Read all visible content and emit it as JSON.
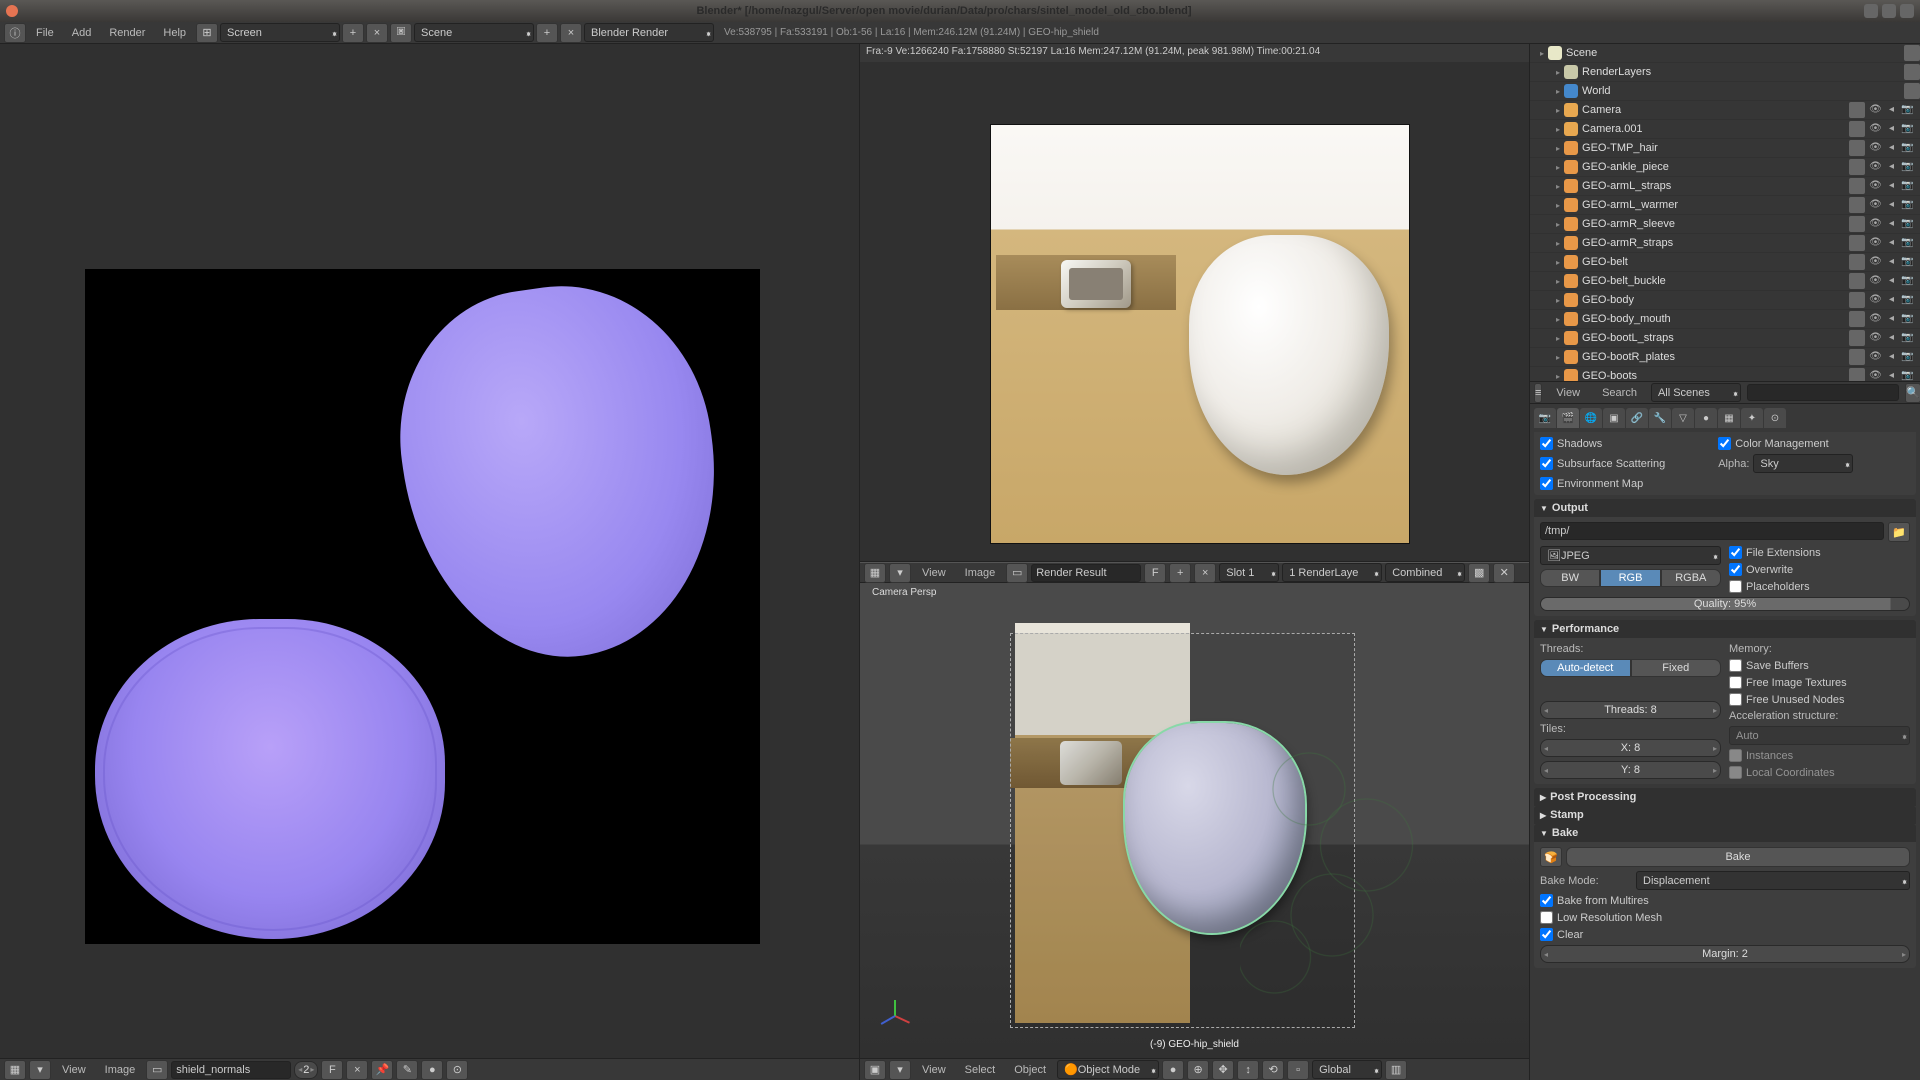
{
  "titlebar": {
    "title": "Blender* [/home/nazgul/Server/open movie/durian/Data/pro/chars/sintel_model_old_cbo.blend]"
  },
  "topmenu": {
    "file": "File",
    "add": "Add",
    "render": "Render",
    "help": "Help",
    "screen": "Screen",
    "scene": "Scene",
    "engine": "Blender Render",
    "stats": "Ve:538795 | Fa:533191 | Ob:1-56 | La:16 | Mem:246.12M (91.24M) | GEO-hip_shield"
  },
  "uvEditor": {
    "footerView": "View",
    "footerImage": "Image",
    "imageName": "shield_normals",
    "users": "2"
  },
  "renderResult": {
    "info": "Fra:-9  Ve:1266240 Fa:1758880 St:52197 La:16 Mem:247.12M (91.24M, peak 981.98M) Time:00:21.04",
    "headerView": "View",
    "headerImage": "Image",
    "headerResult": "Render Result",
    "slot": "Slot 1",
    "layer": "1 RenderLaye",
    "pass": "Combined"
  },
  "viewport3d": {
    "persp": "Camera Persp",
    "selection": "(-9) GEO-hip_shield",
    "footerView": "View",
    "footerSelect": "Select",
    "footerObject": "Object",
    "mode": "Object Mode",
    "orientation": "Global"
  },
  "outliner": {
    "view": "View",
    "search": "Search",
    "filter": "All Scenes",
    "items": [
      {
        "name": "Scene",
        "icon": "oic-scene",
        "indent": 0,
        "tog": false
      },
      {
        "name": "RenderLayers",
        "icon": "oic-render",
        "indent": 1,
        "tog": false
      },
      {
        "name": "World",
        "icon": "oic-world",
        "indent": 1,
        "tog": false
      },
      {
        "name": "Camera",
        "icon": "oic-cam",
        "indent": 1,
        "tog": true
      },
      {
        "name": "Camera.001",
        "icon": "oic-cam",
        "indent": 1,
        "tog": true
      },
      {
        "name": "GEO-TMP_hair",
        "icon": "oic-mesh",
        "indent": 1,
        "tog": true
      },
      {
        "name": "GEO-ankle_piece",
        "icon": "oic-mesh",
        "indent": 1,
        "tog": true
      },
      {
        "name": "GEO-armL_straps",
        "icon": "oic-mesh",
        "indent": 1,
        "tog": true
      },
      {
        "name": "GEO-armL_warmer",
        "icon": "oic-mesh",
        "indent": 1,
        "tog": true
      },
      {
        "name": "GEO-armR_sleeve",
        "icon": "oic-mesh",
        "indent": 1,
        "tog": true
      },
      {
        "name": "GEO-armR_straps",
        "icon": "oic-mesh",
        "indent": 1,
        "tog": true
      },
      {
        "name": "GEO-belt",
        "icon": "oic-mesh",
        "indent": 1,
        "tog": true
      },
      {
        "name": "GEO-belt_buckle",
        "icon": "oic-mesh",
        "indent": 1,
        "tog": true
      },
      {
        "name": "GEO-body",
        "icon": "oic-mesh",
        "indent": 1,
        "tog": true
      },
      {
        "name": "GEO-body_mouth",
        "icon": "oic-mesh",
        "indent": 1,
        "tog": true
      },
      {
        "name": "GEO-bootL_straps",
        "icon": "oic-mesh",
        "indent": 1,
        "tog": true
      },
      {
        "name": "GEO-bootR_plates",
        "icon": "oic-mesh",
        "indent": 1,
        "tog": true
      },
      {
        "name": "GEO-boots",
        "icon": "oic-mesh",
        "indent": 1,
        "tog": true
      }
    ]
  },
  "props": {
    "shading": {
      "shadows": "Shadows",
      "sss": "Subsurface Scattering",
      "envmap": "Environment Map",
      "colorMgmt": "Color Management",
      "alpha": "Alpha:",
      "alphaMode": "Sky"
    },
    "output": {
      "title": "Output",
      "path": "/tmp/",
      "format": "JPEG",
      "bw": "BW",
      "rgb": "RGB",
      "rgba": "RGBA",
      "fileExt": "File Extensions",
      "overwrite": "Overwrite",
      "placeholders": "Placeholders",
      "quality": "Quality: 95%"
    },
    "performance": {
      "title": "Performance",
      "threads": "Threads:",
      "auto": "Auto-detect",
      "fixed": "Fixed",
      "threadsN": "Threads: 8",
      "tiles": "Tiles:",
      "tilesX": "X: 8",
      "tilesY": "Y: 8",
      "memory": "Memory:",
      "saveBuf": "Save Buffers",
      "freeTex": "Free Image Textures",
      "freeNodes": "Free Unused Nodes",
      "accel": "Acceleration structure:",
      "accelMode": "Auto",
      "instances": "Instances",
      "localCoord": "Local Coordinates"
    },
    "postproc": "Post Processing",
    "stamp": "Stamp",
    "bake": {
      "title": "Bake",
      "bakeBtn": "Bake",
      "modeLbl": "Bake Mode:",
      "mode": "Displacement",
      "fromMulti": "Bake from Multires",
      "lowres": "Low Resolution Mesh",
      "clear": "Clear",
      "margin": "Margin: 2"
    }
  }
}
